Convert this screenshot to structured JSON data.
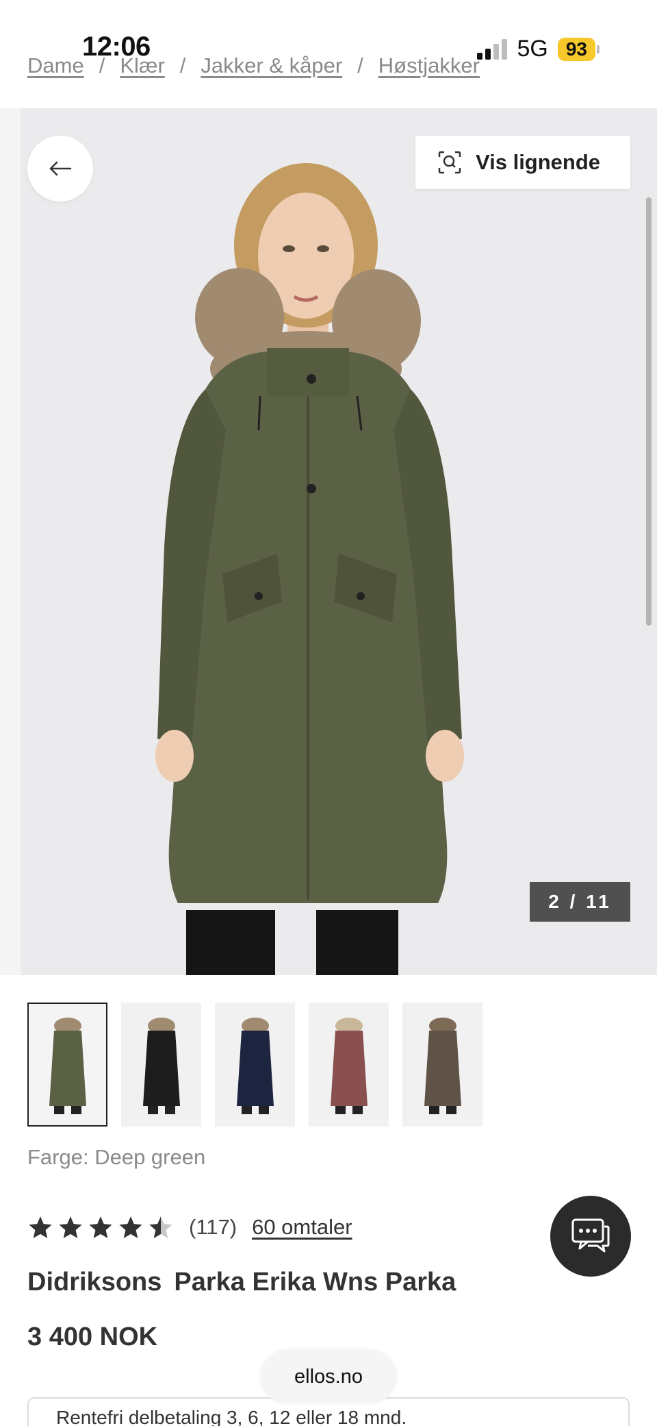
{
  "status_bar": {
    "time": "12:06",
    "network": "5G",
    "battery": "93"
  },
  "breadcrumb": [
    "Dame",
    "Klær",
    "Jakker & kåper",
    "Høstjakker"
  ],
  "breadcrumb_separator": "/",
  "hero": {
    "vis_lignende_label": "Vis lignende",
    "image_counter": "2 / 11",
    "jacket_color": "#5b6145"
  },
  "thumbnails": [
    {
      "name": "Deep green",
      "color": "#5b6145",
      "selected": true
    },
    {
      "name": "Black",
      "color": "#1d1d1d",
      "selected": false
    },
    {
      "name": "Navy",
      "color": "#1e2540",
      "selected": false
    },
    {
      "name": "Rose",
      "color": "#8a4f4f",
      "selected": false
    },
    {
      "name": "Brown",
      "color": "#5e5346",
      "selected": false
    }
  ],
  "color_label": "Farge: Deep green",
  "rating": {
    "stars": 4.5,
    "count": "(117)",
    "reviews_link": "60 omtaler"
  },
  "product": {
    "brand": "Didriksons",
    "name": "Parka Erika Wns Parka",
    "price": "3 400 NOK"
  },
  "domain": "ellos.no",
  "info_text": "Rentefri delbetaling 3, 6, 12 eller 18 mnd.",
  "colors": {
    "hero_bg": "#ebebed",
    "counter_bg": "#505050",
    "chat_bg": "#2b2b2b",
    "battery": "#f7c82a"
  }
}
